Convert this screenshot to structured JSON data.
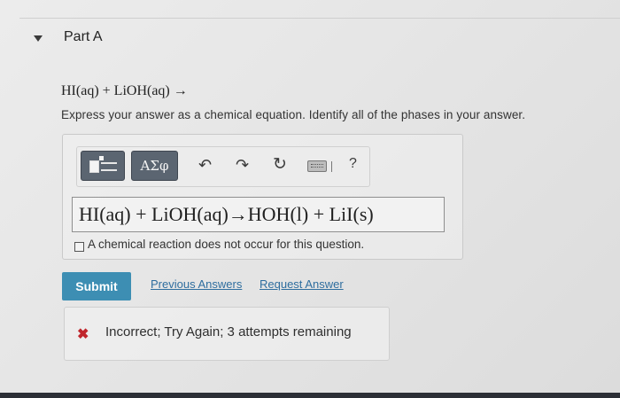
{
  "part": {
    "title": "Part A"
  },
  "question": {
    "equation": "HI(aq) + LiOH(aq) →",
    "instructions": "Express your answer as a chemical equation. Identify all of the phases in your answer."
  },
  "toolbar": {
    "templates_icon": "templates-icon",
    "symbols_label": "ΑΣφ",
    "undo_icon": "↶",
    "redo_icon": "↷",
    "reset_icon": "↻",
    "keyboard_icon": "keyboard-icon",
    "help_label": "?"
  },
  "answer": {
    "value": "HI(aq) + LiOH(aq)→HOH(l) + LiI(s)",
    "no_reaction_label": "A chemical reaction does not occur for this question."
  },
  "actions": {
    "submit_label": "Submit",
    "previous_answers_label": "Previous Answers",
    "request_answer_label": "Request Answer"
  },
  "feedback": {
    "icon": "✖",
    "message": "Incorrect; Try Again; 3 attempts remaining",
    "color": "#c0262c"
  },
  "colors": {
    "submit_bg": "#3d8eb3",
    "toolbar_btn_bg": "#5b6571",
    "link": "#2f6e9f"
  }
}
